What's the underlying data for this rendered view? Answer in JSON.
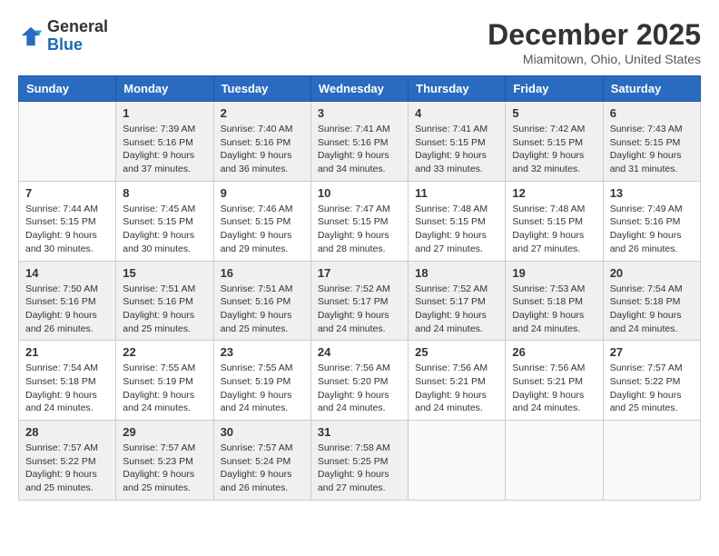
{
  "header": {
    "logo": {
      "general": "General",
      "blue": "Blue"
    },
    "title": "December 2025",
    "location": "Miamitown, Ohio, United States"
  },
  "weekdays": [
    "Sunday",
    "Monday",
    "Tuesday",
    "Wednesday",
    "Thursday",
    "Friday",
    "Saturday"
  ],
  "weeks": [
    [
      {
        "day": "",
        "sunrise": "",
        "sunset": "",
        "daylight": ""
      },
      {
        "day": "1",
        "sunrise": "Sunrise: 7:39 AM",
        "sunset": "Sunset: 5:16 PM",
        "daylight": "Daylight: 9 hours and 37 minutes."
      },
      {
        "day": "2",
        "sunrise": "Sunrise: 7:40 AM",
        "sunset": "Sunset: 5:16 PM",
        "daylight": "Daylight: 9 hours and 36 minutes."
      },
      {
        "day": "3",
        "sunrise": "Sunrise: 7:41 AM",
        "sunset": "Sunset: 5:16 PM",
        "daylight": "Daylight: 9 hours and 34 minutes."
      },
      {
        "day": "4",
        "sunrise": "Sunrise: 7:41 AM",
        "sunset": "Sunset: 5:15 PM",
        "daylight": "Daylight: 9 hours and 33 minutes."
      },
      {
        "day": "5",
        "sunrise": "Sunrise: 7:42 AM",
        "sunset": "Sunset: 5:15 PM",
        "daylight": "Daylight: 9 hours and 32 minutes."
      },
      {
        "day": "6",
        "sunrise": "Sunrise: 7:43 AM",
        "sunset": "Sunset: 5:15 PM",
        "daylight": "Daylight: 9 hours and 31 minutes."
      }
    ],
    [
      {
        "day": "7",
        "sunrise": "Sunrise: 7:44 AM",
        "sunset": "Sunset: 5:15 PM",
        "daylight": "Daylight: 9 hours and 30 minutes."
      },
      {
        "day": "8",
        "sunrise": "Sunrise: 7:45 AM",
        "sunset": "Sunset: 5:15 PM",
        "daylight": "Daylight: 9 hours and 30 minutes."
      },
      {
        "day": "9",
        "sunrise": "Sunrise: 7:46 AM",
        "sunset": "Sunset: 5:15 PM",
        "daylight": "Daylight: 9 hours and 29 minutes."
      },
      {
        "day": "10",
        "sunrise": "Sunrise: 7:47 AM",
        "sunset": "Sunset: 5:15 PM",
        "daylight": "Daylight: 9 hours and 28 minutes."
      },
      {
        "day": "11",
        "sunrise": "Sunrise: 7:48 AM",
        "sunset": "Sunset: 5:15 PM",
        "daylight": "Daylight: 9 hours and 27 minutes."
      },
      {
        "day": "12",
        "sunrise": "Sunrise: 7:48 AM",
        "sunset": "Sunset: 5:15 PM",
        "daylight": "Daylight: 9 hours and 27 minutes."
      },
      {
        "day": "13",
        "sunrise": "Sunrise: 7:49 AM",
        "sunset": "Sunset: 5:16 PM",
        "daylight": "Daylight: 9 hours and 26 minutes."
      }
    ],
    [
      {
        "day": "14",
        "sunrise": "Sunrise: 7:50 AM",
        "sunset": "Sunset: 5:16 PM",
        "daylight": "Daylight: 9 hours and 26 minutes."
      },
      {
        "day": "15",
        "sunrise": "Sunrise: 7:51 AM",
        "sunset": "Sunset: 5:16 PM",
        "daylight": "Daylight: 9 hours and 25 minutes."
      },
      {
        "day": "16",
        "sunrise": "Sunrise: 7:51 AM",
        "sunset": "Sunset: 5:16 PM",
        "daylight": "Daylight: 9 hours and 25 minutes."
      },
      {
        "day": "17",
        "sunrise": "Sunrise: 7:52 AM",
        "sunset": "Sunset: 5:17 PM",
        "daylight": "Daylight: 9 hours and 24 minutes."
      },
      {
        "day": "18",
        "sunrise": "Sunrise: 7:52 AM",
        "sunset": "Sunset: 5:17 PM",
        "daylight": "Daylight: 9 hours and 24 minutes."
      },
      {
        "day": "19",
        "sunrise": "Sunrise: 7:53 AM",
        "sunset": "Sunset: 5:18 PM",
        "daylight": "Daylight: 9 hours and 24 minutes."
      },
      {
        "day": "20",
        "sunrise": "Sunrise: 7:54 AM",
        "sunset": "Sunset: 5:18 PM",
        "daylight": "Daylight: 9 hours and 24 minutes."
      }
    ],
    [
      {
        "day": "21",
        "sunrise": "Sunrise: 7:54 AM",
        "sunset": "Sunset: 5:18 PM",
        "daylight": "Daylight: 9 hours and 24 minutes."
      },
      {
        "day": "22",
        "sunrise": "Sunrise: 7:55 AM",
        "sunset": "Sunset: 5:19 PM",
        "daylight": "Daylight: 9 hours and 24 minutes."
      },
      {
        "day": "23",
        "sunrise": "Sunrise: 7:55 AM",
        "sunset": "Sunset: 5:19 PM",
        "daylight": "Daylight: 9 hours and 24 minutes."
      },
      {
        "day": "24",
        "sunrise": "Sunrise: 7:56 AM",
        "sunset": "Sunset: 5:20 PM",
        "daylight": "Daylight: 9 hours and 24 minutes."
      },
      {
        "day": "25",
        "sunrise": "Sunrise: 7:56 AM",
        "sunset": "Sunset: 5:21 PM",
        "daylight": "Daylight: 9 hours and 24 minutes."
      },
      {
        "day": "26",
        "sunrise": "Sunrise: 7:56 AM",
        "sunset": "Sunset: 5:21 PM",
        "daylight": "Daylight: 9 hours and 24 minutes."
      },
      {
        "day": "27",
        "sunrise": "Sunrise: 7:57 AM",
        "sunset": "Sunset: 5:22 PM",
        "daylight": "Daylight: 9 hours and 25 minutes."
      }
    ],
    [
      {
        "day": "28",
        "sunrise": "Sunrise: 7:57 AM",
        "sunset": "Sunset: 5:22 PM",
        "daylight": "Daylight: 9 hours and 25 minutes."
      },
      {
        "day": "29",
        "sunrise": "Sunrise: 7:57 AM",
        "sunset": "Sunset: 5:23 PM",
        "daylight": "Daylight: 9 hours and 25 minutes."
      },
      {
        "day": "30",
        "sunrise": "Sunrise: 7:57 AM",
        "sunset": "Sunset: 5:24 PM",
        "daylight": "Daylight: 9 hours and 26 minutes."
      },
      {
        "day": "31",
        "sunrise": "Sunrise: 7:58 AM",
        "sunset": "Sunset: 5:25 PM",
        "daylight": "Daylight: 9 hours and 27 minutes."
      },
      {
        "day": "",
        "sunrise": "",
        "sunset": "",
        "daylight": ""
      },
      {
        "day": "",
        "sunrise": "",
        "sunset": "",
        "daylight": ""
      },
      {
        "day": "",
        "sunrise": "",
        "sunset": "",
        "daylight": ""
      }
    ]
  ]
}
